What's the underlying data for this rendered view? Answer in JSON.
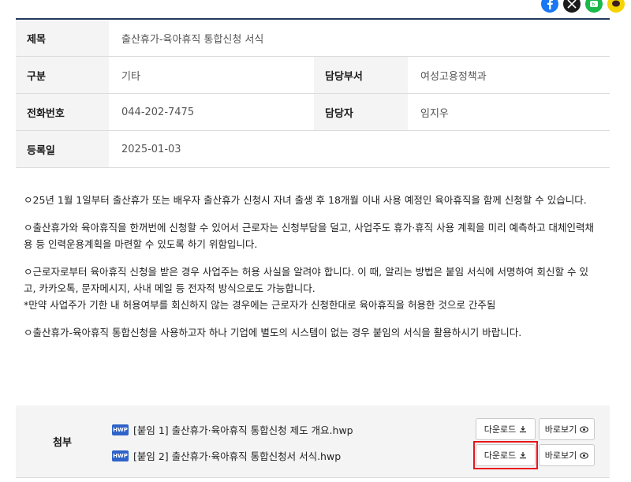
{
  "social": {
    "facebook_icon": "facebook-icon",
    "x_icon": "x-icon",
    "blog_icon": "blog-icon",
    "kakaotalk_icon": "kakaotalk-icon"
  },
  "info": {
    "title_label": "제목",
    "title_value": "출산휴가-육아휴직 통합신청 서식",
    "category_label": "구분",
    "category_value": "기타",
    "dept_label": "담당부서",
    "dept_value": "여성고용정책과",
    "phone_label": "전화번호",
    "phone_value": "044-202-7475",
    "manager_label": "담당자",
    "manager_value": "임지우",
    "date_label": "등록일",
    "date_value": "2025-01-03"
  },
  "body": {
    "p1": "ㅇ25년 1월 1일부터 출산휴가 또는 배우자 출산휴가 신청시 자녀 출생 후 18개월 이내 사용 예정인 육아휴직을 함께 신청할 수 있습니다.",
    "p2": "ㅇ출산휴가와 육아휴직을 한꺼번에 신청할 수 있어서 근로자는 신청부담을 덜고, 사업주도 휴가·휴직 사용 계획을 미리 예측하고 대체인력채용 등 인력운용계획을 마련할 수 있도록 하기 위함입니다.",
    "p3a": "ㅇ근로자로부터 육아휴직 신청을 받은 경우 사업주는 허용 사실을 알려야 합니다. 이 때, 알리는 방법은 붙임 서식에 서명하여 회신할 수 있고, 카카오톡, 문자메시지, 사내 메일 등 전자적 방식으로도 가능합니다.",
    "p3b": "*만약 사업주가 기한 내 허용여부를 회신하지 않는 경우에는 근로자가 신청한대로 육아휴직을 허용한 것으로 간주됨",
    "p4": "ㅇ출산휴가-육아휴직 통합신청을 사용하고자 하나 기업에 별도의 시스템이 없는 경우 붙임의 서식을 활용하시기 바랍니다."
  },
  "attachments": {
    "label": "첨부",
    "file_type": "HWP",
    "files": [
      {
        "name": "[붙임 1] 출산휴가·육아휴직 통합신청 제도 개요.hwp"
      },
      {
        "name": "[붙임 2] 출산휴가·육아휴직 통합신청서 서식.hwp"
      }
    ],
    "download_label": "다운로드",
    "view_label": "바로보기"
  },
  "colors": {
    "header_border": "#233a5e",
    "highlight": "#e8161c",
    "hwp_blue": "#2f63c9"
  }
}
